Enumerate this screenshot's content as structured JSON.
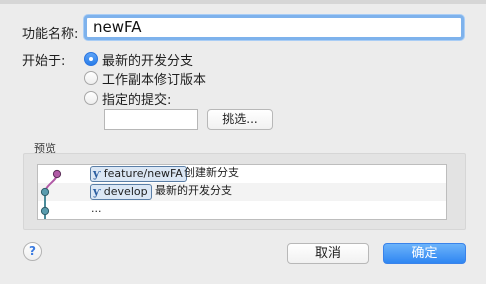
{
  "form": {
    "feature_name_label": "功能名称:",
    "feature_name_value": "newFA",
    "start_at_label": "开始于:",
    "options": [
      {
        "label": "最新的开发分支",
        "checked": true
      },
      {
        "label": "工作副本修订版本",
        "checked": false
      },
      {
        "label": "指定的提交:",
        "checked": false
      }
    ],
    "commit_value": "",
    "choose_button": "挑选..."
  },
  "preview": {
    "label": "预览",
    "rows": [
      {
        "tag": "feature/newFA",
        "message": "创建新分支",
        "dot_color": "#b15aa6"
      },
      {
        "tag": "develop",
        "message": "最新的开发分支",
        "dot_color": "#4a8a99"
      },
      {
        "tag": "",
        "message": "...",
        "dot_color": "#4a8a99"
      }
    ],
    "tag_icon": "branch-icon"
  },
  "buttons": {
    "help": "?",
    "cancel": "取消",
    "ok": "确定"
  },
  "colors": {
    "accent": "#2f86f2",
    "feature_line": "#b15aa6",
    "develop_line": "#4a8a99"
  }
}
